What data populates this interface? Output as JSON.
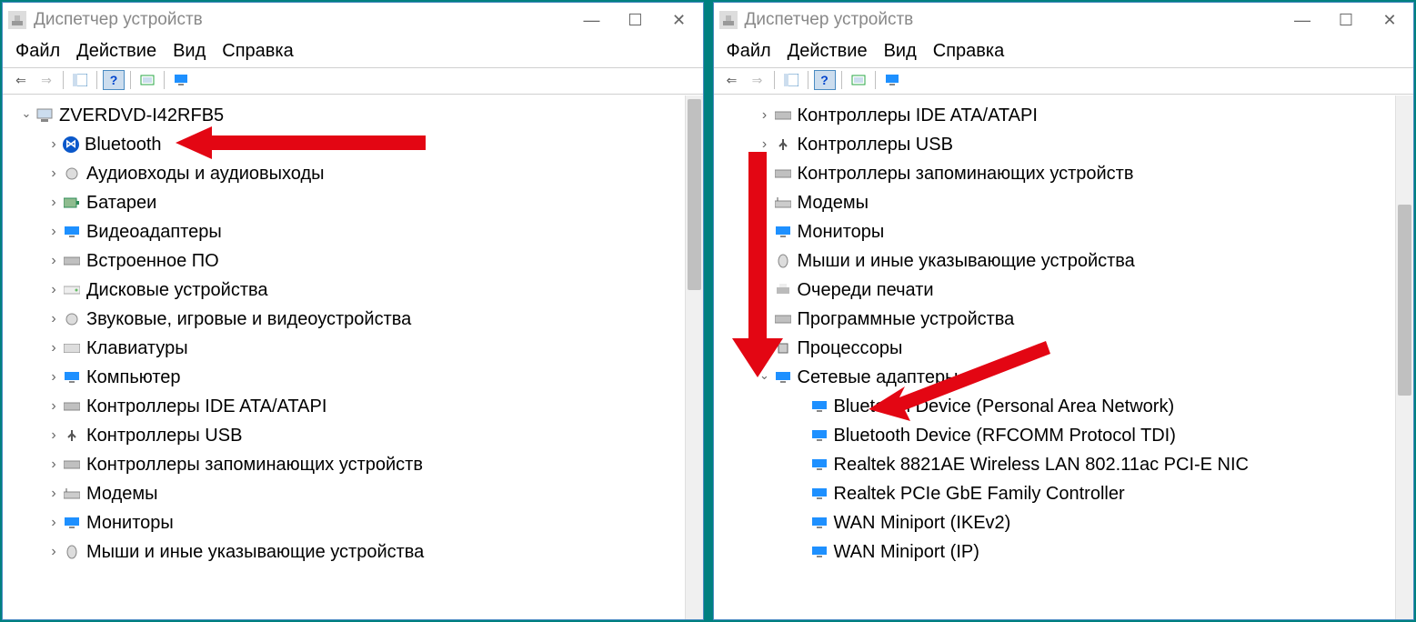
{
  "title": "Диспетчер устройств",
  "menu": {
    "file": "Файл",
    "action": "Действие",
    "view": "Вид",
    "help": "Справка"
  },
  "left": {
    "root": "ZVERDVD-I42RFB5",
    "items": [
      {
        "label": "Bluetooth",
        "icon": "bt"
      },
      {
        "label": "Аудиовходы и аудиовыходы",
        "icon": "audio"
      },
      {
        "label": "Батареи",
        "icon": "bat"
      },
      {
        "label": "Видеоадаптеры",
        "icon": "mon"
      },
      {
        "label": "Встроенное ПО",
        "icon": "card"
      },
      {
        "label": "Дисковые устройства",
        "icon": "disk"
      },
      {
        "label": "Звуковые, игровые и видеоустройства",
        "icon": "audio"
      },
      {
        "label": "Клавиатуры",
        "icon": "kbd"
      },
      {
        "label": "Компьютер",
        "icon": "mon"
      },
      {
        "label": "Контроллеры IDE ATA/ATAPI",
        "icon": "card"
      },
      {
        "label": "Контроллеры USB",
        "icon": "usb"
      },
      {
        "label": "Контроллеры запоминающих устройств",
        "icon": "card"
      },
      {
        "label": "Модемы",
        "icon": "modem"
      },
      {
        "label": "Мониторы",
        "icon": "mon"
      },
      {
        "label": "Мыши и иные указывающие устройства",
        "icon": "mouse"
      }
    ]
  },
  "right": {
    "items": [
      {
        "label": "Контроллеры IDE ATA/ATAPI",
        "icon": "card",
        "chev": "collapsed",
        "level": 1
      },
      {
        "label": "Контроллеры USB",
        "icon": "usb",
        "chev": "collapsed",
        "level": 1
      },
      {
        "label": "Контроллеры запоминающих устройств",
        "icon": "card",
        "chev": "collapsed",
        "level": 1
      },
      {
        "label": "Модемы",
        "icon": "modem",
        "chev": "collapsed",
        "level": 1
      },
      {
        "label": "Мониторы",
        "icon": "mon",
        "chev": "collapsed",
        "level": 1
      },
      {
        "label": "Мыши и иные указывающие устройства",
        "icon": "mouse",
        "chev": "collapsed",
        "level": 1
      },
      {
        "label": "Очереди печати",
        "icon": "print",
        "chev": "collapsed",
        "level": 1
      },
      {
        "label": "Программные устройства",
        "icon": "card",
        "chev": "collapsed",
        "level": 1
      },
      {
        "label": "Процессоры",
        "icon": "cpu",
        "chev": "collapsed",
        "level": 1
      },
      {
        "label": "Сетевые адаптеры",
        "icon": "net",
        "chev": "expanded",
        "level": 1
      },
      {
        "label": "Bluetooth Device (Personal Area Network)",
        "icon": "net",
        "chev": "none",
        "level": 2
      },
      {
        "label": "Bluetooth Device (RFCOMM Protocol TDI)",
        "icon": "net",
        "chev": "none",
        "level": 2
      },
      {
        "label": "Realtek 8821AE Wireless LAN 802.11ac PCI-E NIC",
        "icon": "net",
        "chev": "none",
        "level": 2
      },
      {
        "label": "Realtek PCIe GbE Family Controller",
        "icon": "net",
        "chev": "none",
        "level": 2
      },
      {
        "label": "WAN Miniport (IKEv2)",
        "icon": "net",
        "chev": "none",
        "level": 2
      },
      {
        "label": "WAN Miniport (IP)",
        "icon": "net",
        "chev": "none",
        "level": 2
      }
    ]
  }
}
